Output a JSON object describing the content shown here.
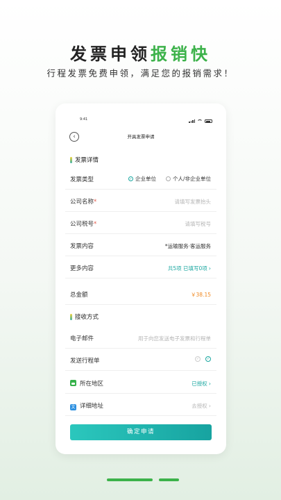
{
  "promo": {
    "headline_main": "发票申领",
    "headline_accent": "报销快",
    "subtitle": "行程发票免费申领，满足您的报销需求！"
  },
  "phone": {
    "status_time": "9:41",
    "back_icon": "chevron-left-icon",
    "title": "开具发票申请",
    "invoice_section": "发票详情",
    "invoice_type_label": "发票类型",
    "type_option_company": "企业单位",
    "type_option_personal": "个人/非企业单位",
    "type_selected": "企业单位",
    "company_name_label": "公司名称",
    "company_name_placeholder": "请填写发票抬头",
    "tax_id_label": "公司税号",
    "tax_id_placeholder": "请填写税号",
    "content_label": "发票内容",
    "content_value": "*运输服务·客运服务",
    "more_label": "更多内容",
    "more_value": "共5项 已填写0项",
    "total_label": "总金额",
    "total_value": "￥38.15",
    "receive_section": "接收方式",
    "email_label": "电子邮件",
    "email_placeholder": "用于向您发送电子发票和行程单",
    "itinerary_label": "发送行程单",
    "region_label": "所在地区",
    "region_value": "已授权",
    "address_label": "详细地址",
    "address_value": "去授权",
    "submit_label": "确定申请"
  },
  "colors": {
    "accent_green": "#3cb24a",
    "teal": "#1aa7a0",
    "orange": "#f08a24",
    "required_red": "#e45a4a"
  },
  "pager": {
    "pages": 2,
    "active": 1
  }
}
